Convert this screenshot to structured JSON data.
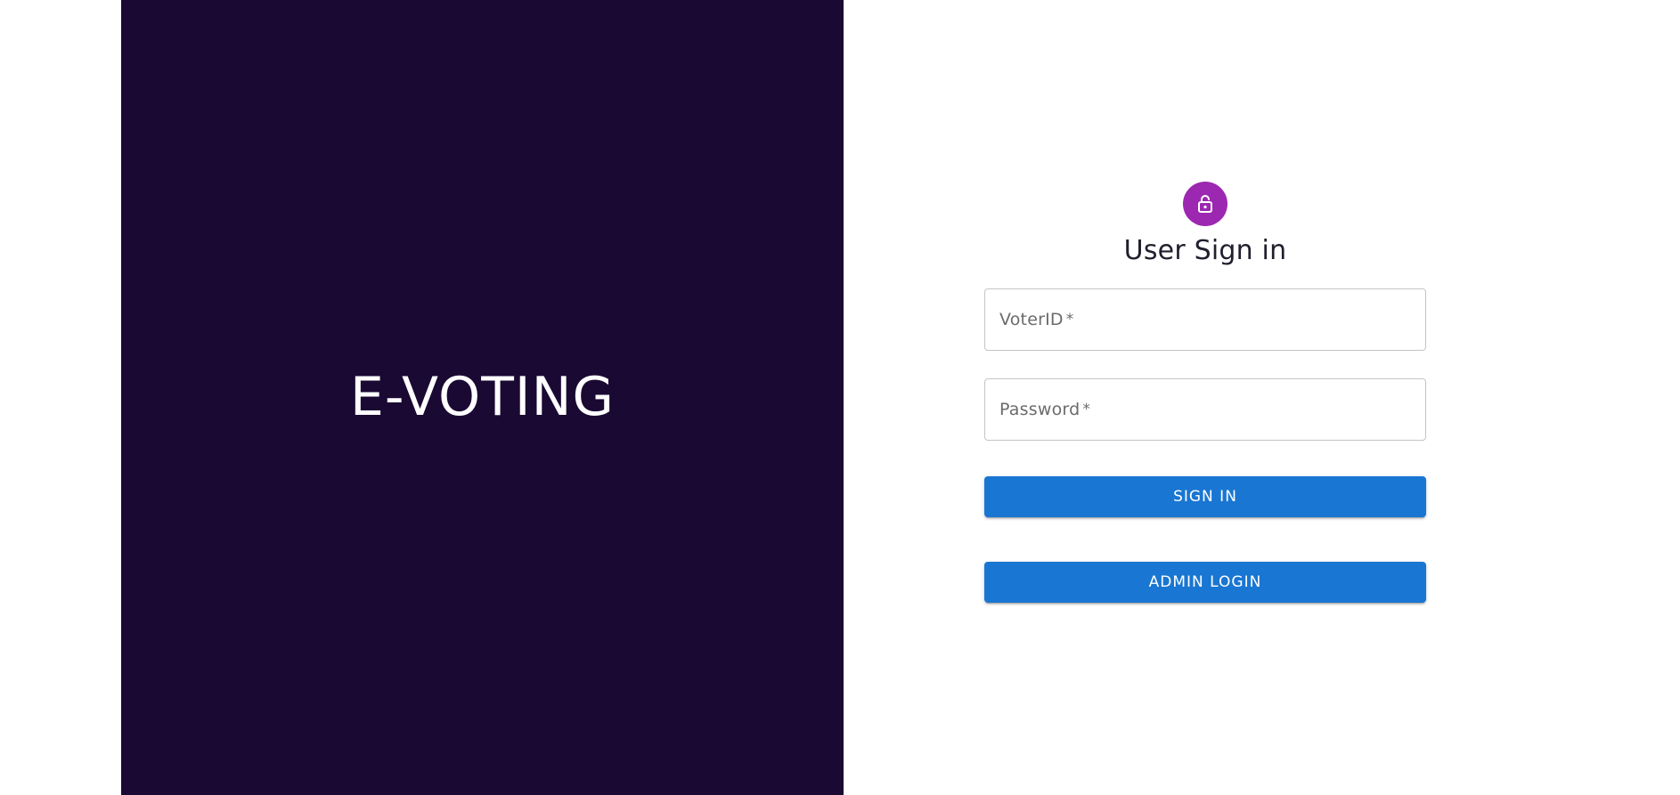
{
  "hero": {
    "title": "E-VOTING",
    "background_color": "#1a0933"
  },
  "signin": {
    "icon": "lock-icon",
    "icon_color": "#9c27b0",
    "title": "User Sign in",
    "fields": [
      {
        "label": "VoterID",
        "required_mark": "*",
        "value": ""
      },
      {
        "label": "Password",
        "required_mark": "*",
        "value": ""
      }
    ],
    "sign_in_label": "SIGN IN",
    "admin_login_label": "ADMIN LOGIN",
    "button_color": "#1976d2"
  }
}
